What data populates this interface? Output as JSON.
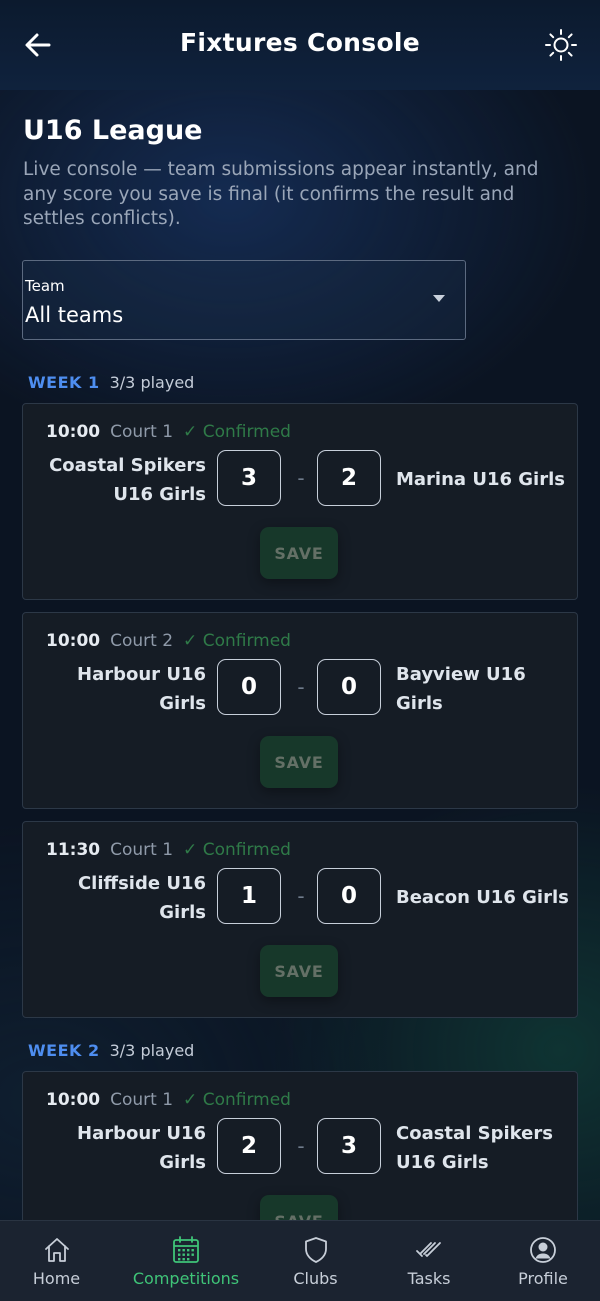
{
  "header": {
    "title": "Fixtures Console",
    "back_icon": "arrow-left-icon",
    "theme_icon": "sun-icon"
  },
  "league": {
    "title": "U16 League",
    "description": "Live console — team submissions appear instantly, and any score you save is final (it confirms the result and settles conflicts)."
  },
  "filter": {
    "label": "Team",
    "value": "All teams"
  },
  "weeks": [
    {
      "label": "WEEK 1",
      "played": "3/3 played",
      "fixtures": [
        {
          "time": "10:00",
          "court": "Court 1",
          "status": "✓ Confirmed",
          "home": "Coastal Spikers U16 Girls",
          "home_score": "3",
          "dash": "-",
          "away_score": "2",
          "away": "Marina U16 Girls",
          "save_label": "SAVE"
        },
        {
          "time": "10:00",
          "court": "Court 2",
          "status": "✓ Confirmed",
          "home": "Harbour U16 Girls",
          "home_score": "0",
          "dash": "-",
          "away_score": "0",
          "away": "Bayview U16 Girls",
          "save_label": "SAVE"
        },
        {
          "time": "11:30",
          "court": "Court 1",
          "status": "✓ Confirmed",
          "home": "Cliffside U16 Girls",
          "home_score": "1",
          "dash": "-",
          "away_score": "0",
          "away": "Beacon U16 Girls",
          "save_label": "SAVE"
        }
      ]
    },
    {
      "label": "WEEK 2",
      "played": "3/3 played",
      "fixtures": [
        {
          "time": "10:00",
          "court": "Court 1",
          "status": "✓ Confirmed",
          "home": "Harbour U16 Girls",
          "home_score": "2",
          "dash": "-",
          "away_score": "3",
          "away": "Coastal Spikers U16 Girls",
          "save_label": "SAVE"
        }
      ]
    }
  ],
  "nav": [
    {
      "label": "Home",
      "icon": "home-icon",
      "active": false
    },
    {
      "label": "Competitions",
      "icon": "calendar-icon",
      "active": true
    },
    {
      "label": "Clubs",
      "icon": "shield-icon",
      "active": false
    },
    {
      "label": "Tasks",
      "icon": "double-check-icon",
      "active": false
    },
    {
      "label": "Profile",
      "icon": "user-circle-icon",
      "active": false
    }
  ],
  "colors": {
    "accent_green": "#3fc478",
    "week_blue": "#4e8ef0",
    "confirmed_green": "#2f7a48",
    "background": "#0b1422"
  }
}
